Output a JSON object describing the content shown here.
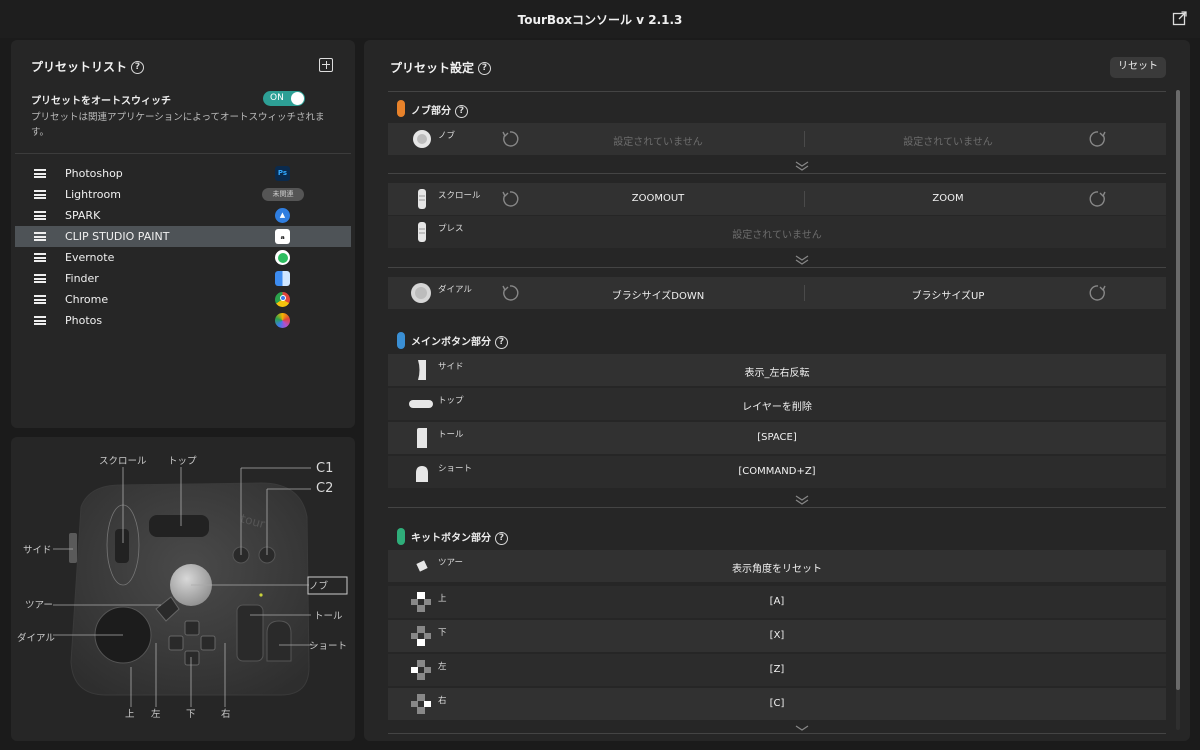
{
  "window": {
    "title": "TourBoxコンソール v 2.1.3"
  },
  "preset_list": {
    "title": "プリセットリスト",
    "help": "?",
    "auto_switch_label": "プリセットをオートスウィッチ",
    "toggle_label": "ON",
    "auto_switch_desc": "プリセットは関連アプリケーションによってオートスウィッチされます。",
    "items": [
      {
        "name": "Photoshop",
        "app_icon": "photoshop-icon",
        "app_text": "Ps",
        "color": "#0a2a4d"
      },
      {
        "name": "Lightroom",
        "badge": "未関連"
      },
      {
        "name": "SPARK",
        "app_icon": "spark-icon",
        "color": "#2f7ee0"
      },
      {
        "name": "CLIP STUDIO PAINT",
        "app_icon": "clip-studio-icon",
        "color": "#ffffff",
        "selected": true
      },
      {
        "name": "Evernote",
        "app_icon": "evernote-icon",
        "color": "#2dbe60"
      },
      {
        "name": "Finder",
        "app_icon": "finder-icon",
        "color": "#3d8cf0"
      },
      {
        "name": "Chrome",
        "app_icon": "chrome-icon",
        "color": "#e0453a"
      },
      {
        "name": "Photos",
        "app_icon": "photos-icon",
        "color": "#f4b400"
      }
    ]
  },
  "device": {
    "labels": {
      "scroll": "スクロール",
      "top": "トップ",
      "c1": "C1",
      "c2": "C2",
      "side": "サイド",
      "knob": "ノブ",
      "tour": "ツアー",
      "tall": "トール",
      "dial": "ダイアル",
      "short": "ショート",
      "up": "上",
      "left": "左",
      "down": "下",
      "right": "右"
    }
  },
  "settings": {
    "title": "プリセット設定",
    "reset_label": "リセット",
    "knob_section": {
      "title": "ノブ部分",
      "color": "#e8822a",
      "rows": [
        {
          "name": "ノブ",
          "left": "設定されていません",
          "right": "設定されていません",
          "empty": true
        }
      ]
    },
    "scroll_section": {
      "rows": [
        {
          "name": "スクロール",
          "left": "ZOOMOUT",
          "right": "ZOOM"
        },
        {
          "name": "プレス",
          "center": "設定されていません",
          "empty": true
        }
      ]
    },
    "dial_section": {
      "rows": [
        {
          "name": "ダイアル",
          "left": "ブラシサイズDOWN",
          "right": "ブラシサイズUP"
        }
      ]
    },
    "main_section": {
      "title": "メインボタン部分",
      "color": "#3a8fd4",
      "rows": [
        {
          "name": "サイド",
          "value": "表示_左右反転"
        },
        {
          "name": "トップ",
          "value": "レイヤーを削除"
        },
        {
          "name": "トール",
          "value": "[SPACE]"
        },
        {
          "name": "ショート",
          "value": "[COMMAND+Z]"
        }
      ]
    },
    "kit_section": {
      "title": "キットボタン部分",
      "color": "#2fae7a",
      "rows": [
        {
          "name": "ツアー",
          "value": "表示角度をリセット"
        },
        {
          "name": "上",
          "value": "[A]"
        },
        {
          "name": "下",
          "value": "[X]"
        },
        {
          "name": "左",
          "value": "[Z]"
        },
        {
          "name": "右",
          "value": "[C]"
        }
      ]
    }
  }
}
